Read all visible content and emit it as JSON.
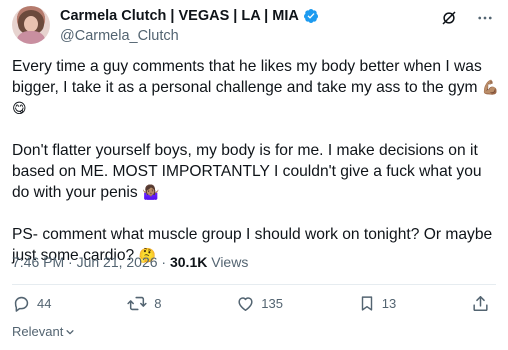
{
  "author": {
    "display_name": "Carmela Clutch | VEGAS | LA | MIA",
    "handle": "@Carmela_Clutch",
    "verified_icon": "verified-badge-icon"
  },
  "top_icons": [
    "grok-icon",
    "more-icon"
  ],
  "tweet": {
    "p1": "Every time a guy comments that he likes my body better when I was bigger, I take it as a personal challenge and take my ass to the gym",
    "p1_emojis": "💪🏽😋",
    "p2": "Don't flatter yourself boys, my body is for me. I make decisions on it based on ME. MOST IMPORTANTLY I couldn't give a fuck what you do with your penis",
    "p2_emojis": "🤷🏽‍♀️",
    "p3": "PS- comment what muscle group I should work on tonight? Or maybe just some cardio?",
    "p3_emojis": "🤔"
  },
  "meta": {
    "time": "7:46 PM · Jun 21, 2026 · ",
    "views_count": "30.1K",
    "views_label": " Views"
  },
  "actions": {
    "replies": "44",
    "reposts": "8",
    "likes": "135",
    "bookmarks": "13"
  },
  "relevant_label": "Relevant",
  "colors": {
    "text": "#0f1419",
    "secondary": "#536471",
    "verified": "#1d9bf0",
    "divider": "#e6ecf0"
  }
}
